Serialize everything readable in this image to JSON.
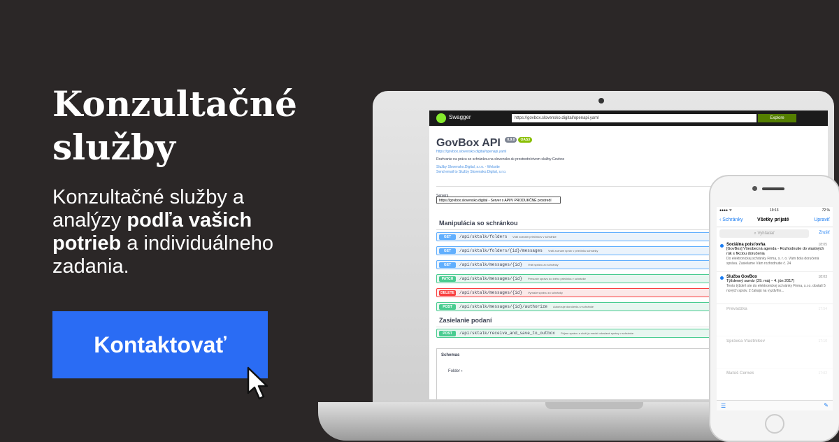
{
  "hero": {
    "title": "Konzultačné služby",
    "sub_part1": "Konzultačné služby a analýzy ",
    "sub_bold": "podľa vašich potrieb",
    "sub_part2": " a individuálneho zadania.",
    "cta_label": "Kontaktovať"
  },
  "laptop": {
    "swagger_logo": "Swagger",
    "url": "https://govbox.slovensko.digital/openapi.yaml",
    "explore_label": "Explore",
    "api_title": "GovBox API",
    "badge_version": "0.9.0",
    "badge_oas": "OAS3",
    "api_link": "https://govbox.slovensko.digital/openapi.yaml",
    "api_desc": "Rozhranie na prácu so schránkou na slovensko.sk prostredníctvom služby Govbox",
    "contact_website": "Služby Slovensko.Digital, s.r.o. - Website",
    "contact_email": "Send email to Služby Slovensko.Digital, s.r.o.",
    "servers_label": "Servers",
    "servers_value": "https://govbox.slovensko.digital - Server s API/V PRODUKČNÉ prostredí",
    "section1": "Manipulácia so schránkou",
    "ops1": [
      {
        "method": "GET",
        "cls": "get",
        "path": "/api/sktalk/folders",
        "desc": "Vráti zoznam priečinkov v schránke"
      },
      {
        "method": "GET",
        "cls": "get",
        "path": "/api/sktalk/folders/{id}/messages",
        "desc": "Vráti zoznam správ v priečinku schránky"
      },
      {
        "method": "GET",
        "cls": "get",
        "path": "/api/sktalk/messages/{id}",
        "desc": "Vráti správu zo schránky"
      },
      {
        "method": "PATCH",
        "cls": "post",
        "path": "/api/sktalk/messages/{id}",
        "desc": "Presunie správu do iného priečinka v schránke"
      },
      {
        "method": "DELETE",
        "cls": "del",
        "path": "/api/sktalk/messages/{id}",
        "desc": "Vymaže správu zo schránky"
      },
      {
        "method": "POST",
        "cls": "post",
        "path": "/api/sktalk/messages/{id}/authorize",
        "desc": "Autorizuje doručenku v schránke"
      }
    ],
    "section2": "Zasielanie podaní",
    "ops2": [
      {
        "method": "POST",
        "cls": "post",
        "path": "/api/sktalk/receive_and_save_to_outbox",
        "desc": "Prijme správu a uloží ju medzi odoslané správy v schránke"
      }
    ],
    "schemas_title": "Schemas",
    "schemas_item": "Folder"
  },
  "phone": {
    "status_left": "●●●● ᯤ",
    "status_time": "19:13",
    "status_right": "72 %",
    "back_label": "‹ Schránky",
    "nav_title": "Všetky prijaté",
    "edit_label": "Upraviť",
    "search_placeholder": "⌕ Vyhľadať",
    "search_cancel": "Zrušiť",
    "messages": [
      {
        "sender": "Sociálna poisťovňa",
        "time": "18:05",
        "subject": "[GovBox] Všeobecná agenda - Rozhodnutie do vlastných rúk s fikciou doručenia",
        "preview": "Do elektronickej schránky Firma, s. r. o. Vám bola doručená správa. Zasielame Vám rozhodnutie č. 24"
      },
      {
        "sender": "Služba GovBox",
        "time": "18:03",
        "subject": "Týždenný sumár (29. máj – 4. jún 2017)",
        "preview": "Tento týždeň ste do elektronickej schránky Firma, s.r.o. dostali 5 nových správ. 2 čakajú na vyzdvihn..."
      },
      {
        "sender": "Prevádzka",
        "time": "17:54",
        "subject": "",
        "preview": ""
      },
      {
        "sender": "Správca Vlastníkov",
        "time": "17:10",
        "subject": "",
        "preview": ""
      },
      {
        "sender": "Matúš Černek",
        "time": "17:02",
        "subject": "",
        "preview": ""
      }
    ]
  }
}
